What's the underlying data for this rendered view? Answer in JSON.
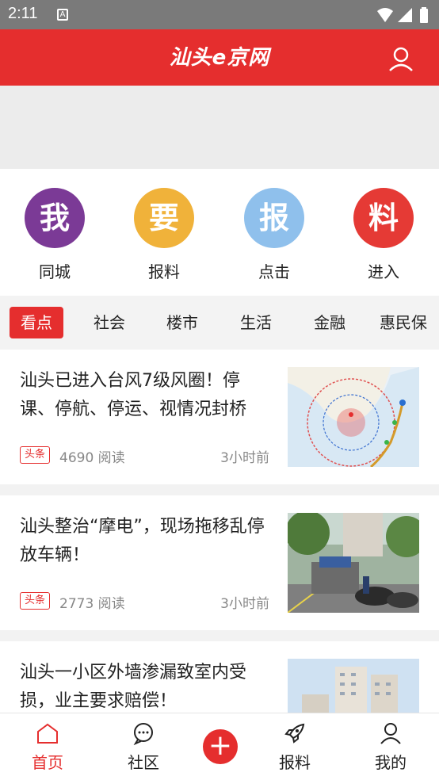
{
  "status_bar": {
    "time": "2:11",
    "a_icon": "A"
  },
  "header": {
    "logo": "汕头e京网",
    "user_icon": "user-icon"
  },
  "quick_actions": [
    {
      "char": "我",
      "label": "同城",
      "color": "#7b3a96"
    },
    {
      "char": "要",
      "label": "报料",
      "color": "#f0b23a"
    },
    {
      "char": "报",
      "label": "点击",
      "color": "#8fc0ec"
    },
    {
      "char": "料",
      "label": "进入",
      "color": "#e53a35"
    }
  ],
  "tabs": [
    "看点",
    "社会",
    "楼市",
    "生活",
    "金融",
    "惠民保"
  ],
  "news": [
    {
      "title": "汕头已进入台风7级风圈！停课、停航、停运、视情况封桥",
      "badge": "头条",
      "reads": "4690 阅读",
      "time": "3小时前",
      "image": "typhoon-map"
    },
    {
      "title": "汕头整治“摩电”，现场拖移乱停放车辆！",
      "badge": "头条",
      "reads": "2773 阅读",
      "time": "3小时前",
      "image": "street-scooters"
    },
    {
      "title": "汕头一小区外墙渗漏致室内受损，业主要求赔偿！",
      "badge": "",
      "reads": "",
      "time": "",
      "image": "apartment-buildings"
    }
  ],
  "bottom_nav": [
    {
      "label": "首页",
      "icon": "home-icon"
    },
    {
      "label": "社区",
      "icon": "chat-icon"
    },
    {
      "label": "",
      "icon": "plus-icon"
    },
    {
      "label": "报料",
      "icon": "rocket-icon"
    },
    {
      "label": "我的",
      "icon": "user-icon"
    }
  ],
  "colors": {
    "brand": "#e52e2e"
  }
}
